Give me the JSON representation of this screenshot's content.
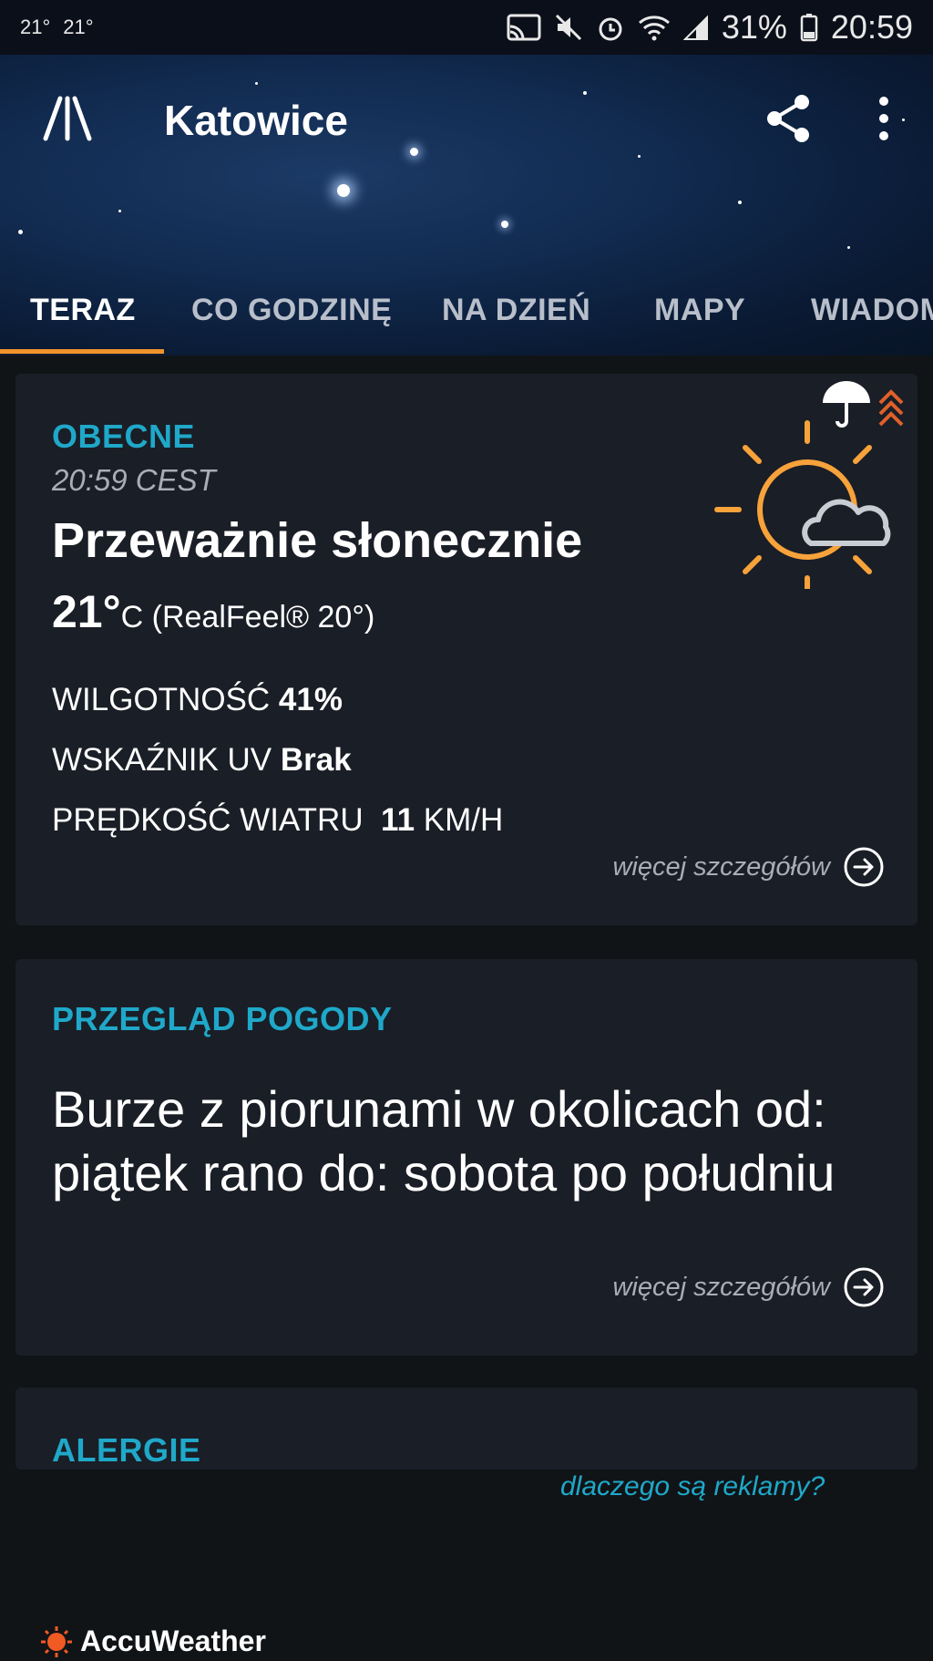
{
  "status_bar": {
    "left_temp_a": "21°",
    "left_temp_b": "21°",
    "battery": "31%",
    "time": "20:59",
    "icons": [
      "cast-icon",
      "mute-icon",
      "alarm-icon",
      "wifi-icon",
      "signal-icon",
      "battery-icon"
    ]
  },
  "header": {
    "city": "Katowice",
    "icons": [
      "app-logo-icon",
      "share-icon",
      "more-vert-icon"
    ]
  },
  "tabs": [
    {
      "label": "TERAZ",
      "active": true
    },
    {
      "label": "CO GODZINĘ",
      "active": false
    },
    {
      "label": "NA DZIEŃ",
      "active": false
    },
    {
      "label": "MAPY",
      "active": false
    },
    {
      "label": "WIADOM",
      "active": false
    }
  ],
  "current": {
    "title": "OBECNE",
    "time": "20:59 CEST",
    "condition": "Przeważnie słonecznie",
    "temp_value": "21°",
    "temp_unit": "C",
    "realfeel": "(RealFeel® 20°)",
    "humidity_label": "WILGOTNOŚĆ",
    "humidity_value": "41%",
    "uv_label": "WSKAŹNIK UV",
    "uv_value": "Brak",
    "wind_label": "PRĘDKOŚĆ WIATRU",
    "wind_value": "11",
    "wind_unit": "KM/H",
    "more": "więcej szczegółów",
    "icons": [
      "mostly-sunny-icon",
      "umbrella-icon",
      "chevrons-up-icon"
    ]
  },
  "overview": {
    "title": "PRZEGLĄD POGODY",
    "text": "Burze z piorunami w okolicach od: piątek rano do: sobota po południu",
    "more": "więcej szczegółów"
  },
  "allergies": {
    "title": "ALERGIE"
  },
  "ad": {
    "why_ads": "dlaczego są reklamy?"
  },
  "brand": {
    "name": "AccuWeather"
  },
  "colors": {
    "accent": "#1fa8c9",
    "tab_indicator": "#f0932b",
    "sun": "#f7a23b",
    "card_bg": "#1a1e26",
    "page_bg": "#111417"
  }
}
